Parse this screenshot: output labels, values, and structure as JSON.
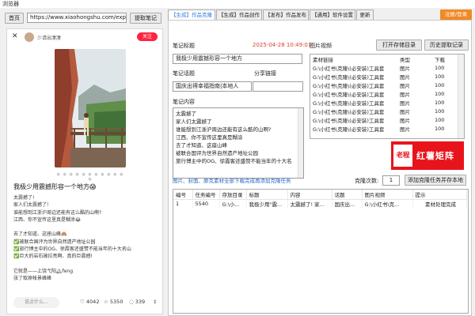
{
  "window": {
    "title": "浏览器"
  },
  "browser": {
    "home_label": "首页",
    "url": "https://www.xiaohongshu.com/explore",
    "extract_label": "提取笔记",
    "author": "少请出凄凄",
    "follow_label": "关注",
    "post_title": "我极少用震撼形容一个地方😱",
    "post_lines": [
      "太震撼了!",
      "家人们太震撼了!",
      "谁能想到江浙沪周边还能有这么酷的山啊?",
      "江西、你不宣传这里真是糊涂😂",
      "",
      "去了才知道、这座山峰🙈",
      "✅被联合国评为世界自然遗产地址公园",
      "✅旅行博主中的OG、徐霞客还盛赞不能当年的十大名山",
      "✅巨大的岩石被拉亮啊、真的巨震撼!",
      "",
      "它就是——上饶弋阳🏔feng",
      "张了取原帐景峰峰"
    ],
    "comment_placeholder": "说点什么...",
    "likes": "4042",
    "collects": "5350",
    "comments": "339",
    "slide_dots": "● ● ● ● ● ● ● ● ● ● ● ●"
  },
  "tabs": [
    "【生成】作品克隆",
    "【生成】作品创作",
    "【发布】作品发布",
    "【通用】软件设置",
    "更新"
  ],
  "logout_label": "注册/登录",
  "form": {
    "note_title_label": "笔记标题",
    "datetime": "2025-04-28 10:49:01",
    "note_title_value": "我极少用震撼形容一个地方",
    "topic_label": "笔记话题",
    "share_label": "分享链接",
    "topic_value": "国庆出得幸福指南|本地人",
    "share_value": "",
    "content_label": "笔记内容",
    "content_lines": [
      "太震撼了",
      "家人们太震撼了",
      "谁能想到江浙沪周边还能有这么酷的山啊?",
      "江西、你不宣传这里真是糊涂",
      "去了才知道、这座山峰",
      "被联合国评为世界自然遗产地址公园",
      "旅行博主中的OG、徐霞客还盛赞不能当年的十大名"
    ]
  },
  "media": {
    "label": "图片视频",
    "open_dir_label": "打开存储目录",
    "history_label": "历史提取记录",
    "columns": [
      "素材链接",
      "类型",
      "下载"
    ],
    "rows": [
      [
        "G:\\小红书\\克隆\\(必安装)工具套",
        "图片",
        "100"
      ],
      [
        "G:\\小红书\\克隆\\(必安装)工具套",
        "图片",
        "100"
      ],
      [
        "G:\\小红书\\克隆\\(必安装)工具套",
        "图片",
        "100"
      ],
      [
        "G:\\小红书\\克隆\\(必安装)工具套",
        "图片",
        "100"
      ],
      [
        "G:\\小红书\\克隆\\(必安装)工具套",
        "图片",
        "100"
      ],
      [
        "G:\\小红书\\克隆\\(必安装)工具套",
        "图片",
        "100"
      ],
      [
        "G:\\小红书\\克隆\\(必安装)工具套",
        "图片",
        "100"
      ],
      [
        "G:\\小红书\\克隆\\(必安装)工具套",
        "图片",
        "100"
      ]
    ]
  },
  "task_bar": {
    "hint": "图片、封面、原克素材全部下载完成再添加克隆任务",
    "retry_label": "克隆次数:",
    "retry_value": "1",
    "add_label": "添加克隆任务并存本地"
  },
  "tasks": {
    "columns": [
      "编号",
      "任务编号",
      "存放目录",
      "标题",
      "内容",
      "话题",
      "图片视频",
      "提示"
    ],
    "rows": [
      [
        "1",
        "5540",
        "G:\\小...",
        "我极少用\"震...",
        "太震撼了! 家...",
        "国庆出...",
        "G:\\小红书\\克...",
        "素材处理完成"
      ]
    ]
  },
  "watermark": {
    "badge": "老程",
    "text": "红薯矩阵"
  }
}
